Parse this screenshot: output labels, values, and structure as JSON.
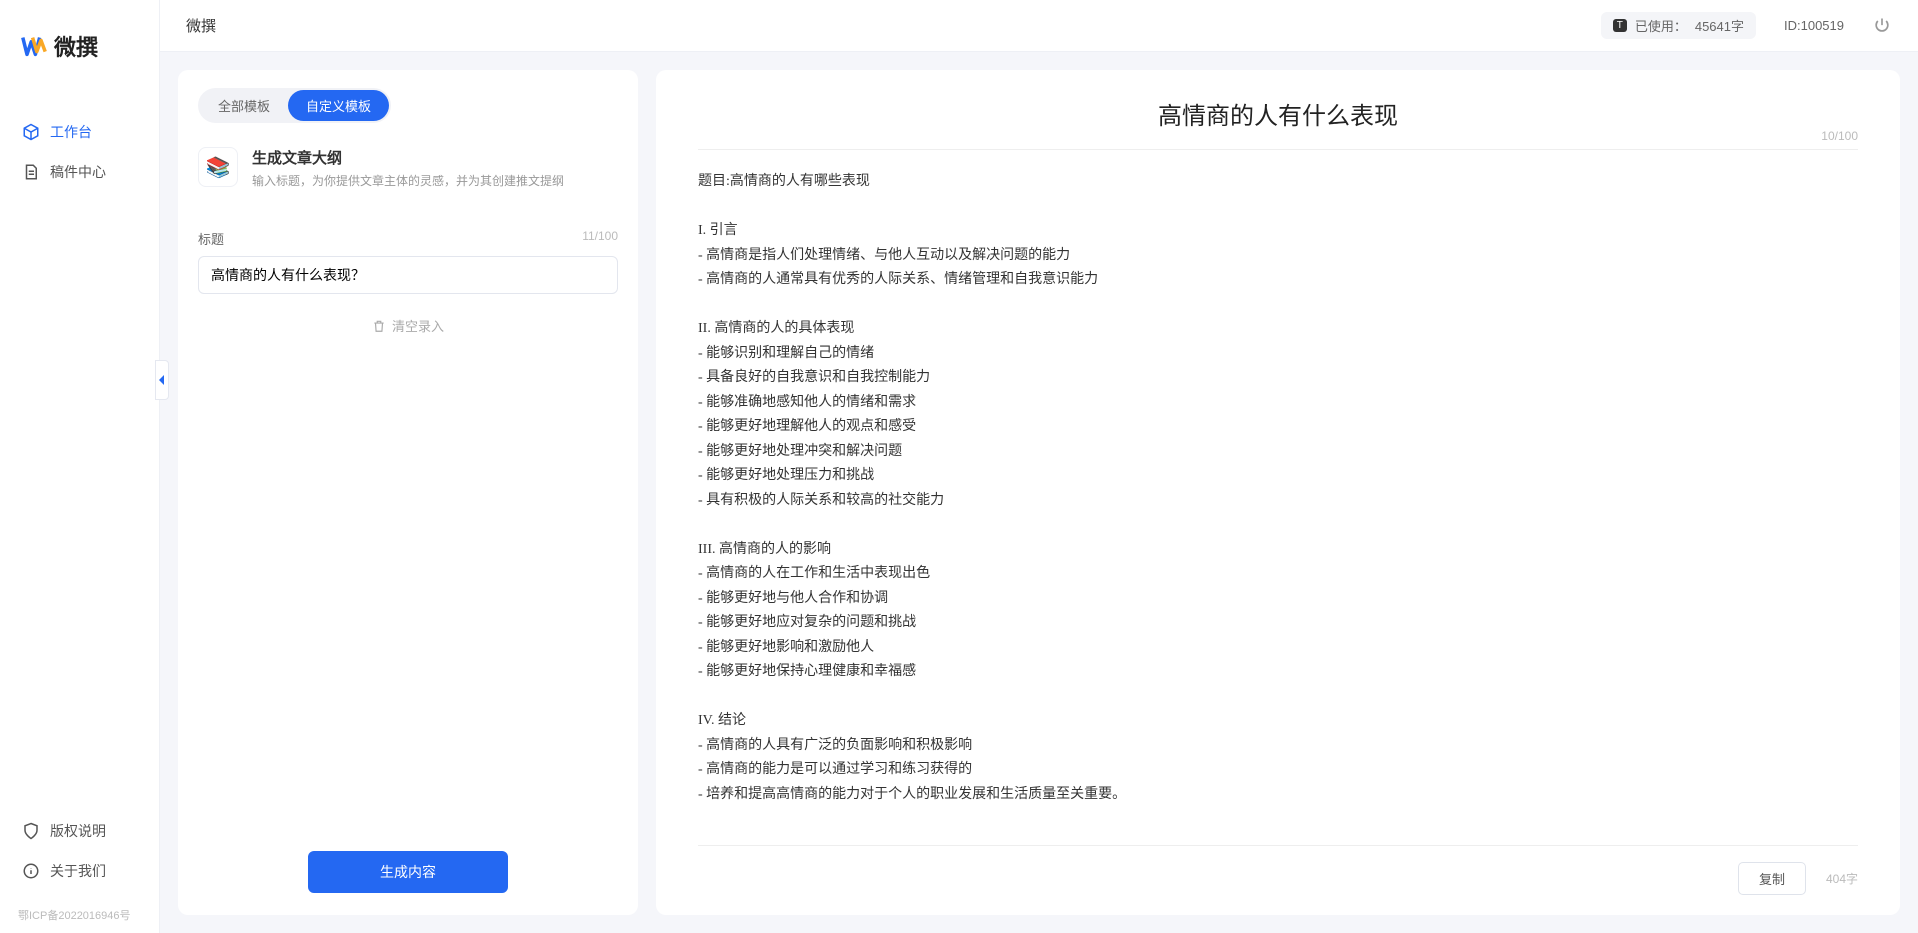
{
  "brand": {
    "name": "微撰"
  },
  "sidebar": {
    "items": [
      {
        "label": "工作台",
        "active": true
      },
      {
        "label": "稿件中心",
        "active": false
      }
    ],
    "bottom": [
      {
        "label": "版权说明"
      },
      {
        "label": "关于我们"
      }
    ],
    "icp": "鄂ICP备2022016946号"
  },
  "topbar": {
    "title": "微撰",
    "usage_label": "已使用：",
    "usage_value": "45641字",
    "usage_badge": "T",
    "id_label": "ID:100519"
  },
  "left": {
    "tabs": [
      {
        "label": "全部模板",
        "active": false
      },
      {
        "label": "自定义模板",
        "active": true
      }
    ],
    "template": {
      "title": "生成文章大纲",
      "desc": "输入标题，为你提供文章主体的灵感，并为其创建推文提纲",
      "icon_emoji": "📚"
    },
    "field_label": "标题",
    "field_count": "11/100",
    "title_value": "高情商的人有什么表现？",
    "clear_label": "清空录入",
    "generate_label": "生成内容"
  },
  "right": {
    "title": "高情商的人有什么表现",
    "title_count": "10/100",
    "body": "题目:高情商的人有哪些表现\n\nI. 引言\n- 高情商是指人们处理情绪、与他人互动以及解决问题的能力\n- 高情商的人通常具有优秀的人际关系、情绪管理和自我意识能力\n\nII. 高情商的人的具体表现\n- 能够识别和理解自己的情绪\n- 具备良好的自我意识和自我控制能力\n- 能够准确地感知他人的情绪和需求\n- 能够更好地理解他人的观点和感受\n- 能够更好地处理冲突和解决问题\n- 能够更好地处理压力和挑战\n- 具有积极的人际关系和较高的社交能力\n\nIII. 高情商的人的影响\n- 高情商的人在工作和生活中表现出色\n- 能够更好地与他人合作和协调\n- 能够更好地应对复杂的问题和挑战\n- 能够更好地影响和激励他人\n- 能够更好地保持心理健康和幸福感\n\nIV. 结论\n- 高情商的人具有广泛的负面影响和积极影响\n- 高情商的能力是可以通过学习和练习获得的\n- 培养和提高高情商的能力对于个人的职业发展和生活质量至关重要。",
    "copy_label": "复制",
    "word_count": "404字"
  }
}
